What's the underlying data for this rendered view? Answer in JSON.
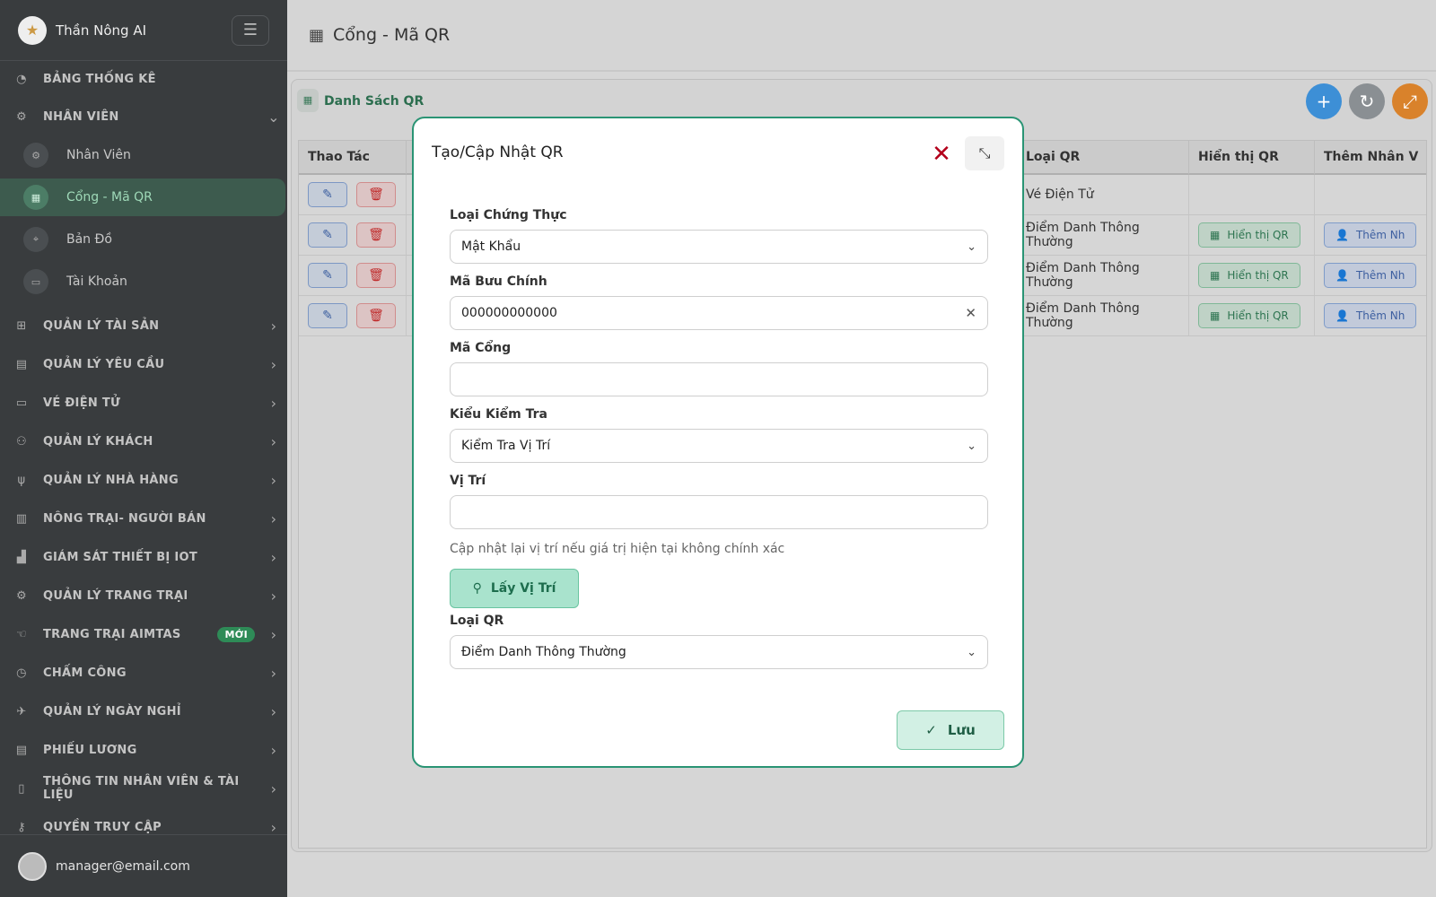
{
  "app": {
    "brand": "Thần Nông AI"
  },
  "sidebar": {
    "items": [
      {
        "label": "BẢNG THỐNG KÊ",
        "icon": "gauge-icon"
      },
      {
        "label": "NHÂN VIÊN",
        "icon": "users-gear-icon",
        "expanded": true
      },
      {
        "label": "QUẢN LÝ TÀI SẢN",
        "icon": "assets-icon"
      },
      {
        "label": "QUẢN LÝ YÊU CẦU",
        "icon": "clipboard-icon"
      },
      {
        "label": "VÉ ĐIỆN TỬ",
        "icon": "ticket-icon"
      },
      {
        "label": "QUẢN LÝ KHÁCH",
        "icon": "guests-icon"
      },
      {
        "label": "QUẢN LÝ NHÀ HÀNG",
        "icon": "utensils-icon"
      },
      {
        "label": "NÔNG TRẠI- NGƯỜI BÁN",
        "icon": "store-icon"
      },
      {
        "label": "GIÁM SÁT THIẾT BỊ IOT",
        "icon": "iot-icon"
      },
      {
        "label": "QUẢN LÝ TRANG TRẠI",
        "icon": "tractor-icon"
      },
      {
        "label": "TRANG TRẠI AIMTAS",
        "icon": "hand-icon",
        "badge": "MỚI"
      },
      {
        "label": "CHẤM CÔNG",
        "icon": "clock-icon"
      },
      {
        "label": "QUẢN LÝ NGÀY NGHỈ",
        "icon": "plane-icon"
      },
      {
        "label": "PHIẾU LƯƠNG",
        "icon": "payslip-icon"
      },
      {
        "label": "THÔNG TIN NHÂN VIÊN & TÀI LIỆU",
        "icon": "docs-icon"
      },
      {
        "label": "QUYỀN TRUY CẬP",
        "icon": "key-icon"
      }
    ],
    "sub_items": [
      {
        "label": "Nhân Viên"
      },
      {
        "label": "Cổng - Mã QR",
        "active": true
      },
      {
        "label": "Bản Đồ"
      },
      {
        "label": "Tài Khoản"
      }
    ],
    "user_email": "manager@email.com"
  },
  "header": {
    "title": "Cổng - Mã QR"
  },
  "card": {
    "title": "Danh Sách QR"
  },
  "table": {
    "columns": [
      "Thao Tác",
      "Loại QR",
      "Hiển thị QR",
      "Thêm Nhân V"
    ],
    "rows": [
      {
        "loai_qr": "Vé Điện Tử",
        "show_qr": "",
        "add_staff": ""
      },
      {
        "loai_qr": "Điểm Danh Thông Thường",
        "show_qr": "Hiển thị QR",
        "add_staff": "Thêm Nh"
      },
      {
        "loai_qr": "Điểm Danh Thông Thường",
        "show_qr": "Hiển thị QR",
        "add_staff": "Thêm Nh"
      },
      {
        "loai_qr": "Điểm Danh Thông Thường",
        "show_qr": "Hiển thị QR",
        "add_staff": "Thêm Nh"
      }
    ]
  },
  "modal": {
    "title": "Tạo/Cập Nhật QR",
    "fields": {
      "auth_type": {
        "label": "Loại Chứng Thực",
        "value": "Mật Khẩu"
      },
      "postal_code": {
        "label": "Mã Bưu Chính",
        "value": "000000000000"
      },
      "gate_code": {
        "label": "Mã Cổng",
        "value": ""
      },
      "check_type": {
        "label": "Kiểu Kiểm Tra",
        "value": "Kiểm Tra Vị Trí"
      },
      "location": {
        "label": "Vị Trí",
        "value": "",
        "hint": "Cập nhật lại vị trí nếu giá trị hiện tại không chính xác"
      },
      "qr_type": {
        "label": "Loại QR",
        "value": "Điểm Danh Thông Thường"
      }
    },
    "get_location_label": "Lấy Vị Trí",
    "save_label": "Lưu"
  },
  "colors": {
    "accent": "#2a9474",
    "close": "#b3001b",
    "fab_add": "#3d8fd6",
    "fab_refresh": "#8a8f93",
    "fab_expand": "#d9822b"
  }
}
